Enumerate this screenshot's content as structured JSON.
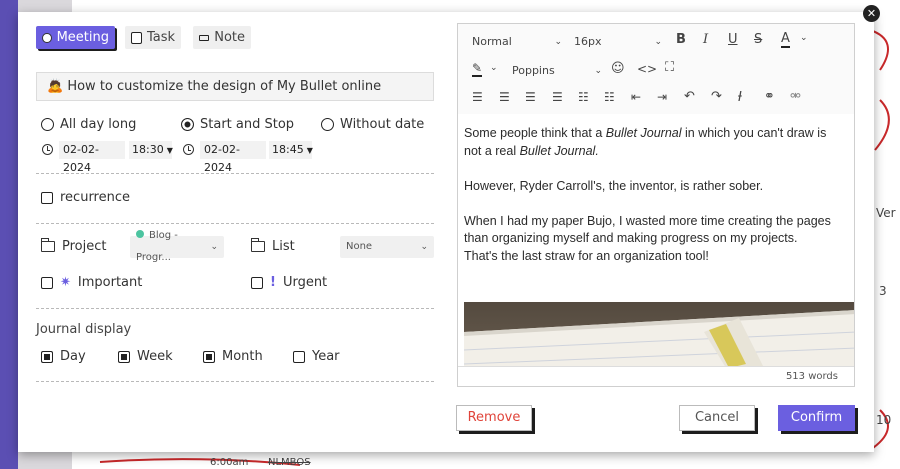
{
  "background": {
    "texts": [
      "Ver",
      "3",
      "10",
      "6:00am",
      "NLMBOS"
    ]
  },
  "modal": {
    "close_glyph": "✕",
    "types": [
      {
        "label": "Meeting",
        "active": true
      },
      {
        "label": "Task",
        "active": false
      },
      {
        "label": "Note",
        "active": false
      }
    ],
    "title_emoji": "🙇",
    "title_value": "How to customize the design of My Bullet online",
    "date_options": [
      {
        "label": "All day long",
        "selected": false
      },
      {
        "label": "Start and Stop",
        "selected": true
      },
      {
        "label": "Without date",
        "selected": false
      }
    ],
    "start": {
      "date": "02-02-2024",
      "time": "18:30"
    },
    "end": {
      "date": "02-02-2024",
      "time": "18:45"
    },
    "recurrence_label": "recurrence",
    "project_label": "Project",
    "project_value": "Blog - Progr...",
    "list_label": "List",
    "list_value": "None",
    "important_label": "Important",
    "urgent_label": "Urgent",
    "journal_label": "Journal display",
    "journal_options": [
      {
        "label": "Day",
        "checked": true
      },
      {
        "label": "Week",
        "checked": true
      },
      {
        "label": "Month",
        "checked": true
      },
      {
        "label": "Year",
        "checked": false
      }
    ],
    "remove_label": "Remove",
    "cancel_label": "Cancel",
    "confirm_label": "Confirm",
    "colors": {
      "accent": "#6b5fe0",
      "remove": "#e0443a",
      "project_dot": "#4cc4a0",
      "important": "#6b5fe0",
      "urgent": "#6b5fe0"
    }
  },
  "editor": {
    "style_value": "Normal",
    "size_value": "16px",
    "font_value": "Poppins",
    "word_count": "513 words",
    "paragraphs": {
      "p1_a": "Some people think that a ",
      "p1_b": "Bullet Journal",
      "p1_c": " in which you can't draw is not a real ",
      "p1_d": "Bullet Journal.",
      "p2": "However, Ryder Carroll's, the inventor, is rather sober.",
      "p3": "When I had my paper Bujo, I wasted more time creating the pages than organizing myself and making progress on my projects.",
      "p4": "That's the last straw for an organization tool!"
    }
  }
}
